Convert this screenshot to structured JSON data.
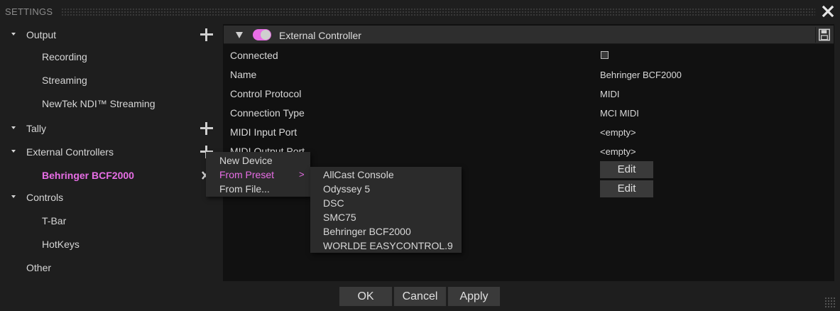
{
  "window": {
    "title": "SETTINGS"
  },
  "sidebar": {
    "items": [
      {
        "label": "Output"
      },
      {
        "label": "Recording"
      },
      {
        "label": "Streaming"
      },
      {
        "label": "NewTek NDI™ Streaming"
      },
      {
        "label": "Tally"
      },
      {
        "label": "External Controllers"
      },
      {
        "label": "Behringer BCF2000"
      },
      {
        "label": "Controls"
      },
      {
        "label": "T-Bar"
      },
      {
        "label": "HotKeys"
      },
      {
        "label": "Other"
      }
    ]
  },
  "panel": {
    "header_title": "External Controller",
    "enabled": true,
    "properties": [
      {
        "label": "Connected",
        "checked": false
      },
      {
        "label": "Name",
        "value": "Behringer BCF2000"
      },
      {
        "label": "Control Protocol",
        "value": "MIDI"
      },
      {
        "label": "Connection Type",
        "value": "MCI MIDI"
      },
      {
        "label": "MIDI Input Port",
        "value": "<empty>"
      },
      {
        "label": "MIDI Output Port",
        "value": "<empty>"
      }
    ],
    "edit_buttons": [
      "Edit",
      "Edit"
    ]
  },
  "context_menu": {
    "items": [
      "New Device",
      "From Preset",
      "From File..."
    ],
    "submenu_arrow": ">"
  },
  "preset_submenu": {
    "items": [
      "AllCast Console",
      "Odyssey 5",
      "DSC",
      "SMC75",
      "Behringer BCF2000",
      "WORLDE EASYCONTROL.9"
    ]
  },
  "footer": {
    "ok": "OK",
    "cancel": "Cancel",
    "apply": "Apply"
  },
  "colors": {
    "accent": "#e86ee6",
    "background": "#1e1e1e",
    "panel": "#111111",
    "button": "#3a3a3a"
  },
  "icons": {
    "close": "close-icon",
    "add": "plus-icon",
    "save": "floppy-disk-icon",
    "expand": "triangle-down-icon"
  }
}
